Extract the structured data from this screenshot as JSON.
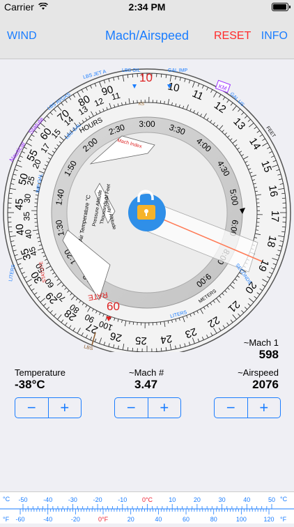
{
  "status": {
    "carrier": "Carrier",
    "time": "2:34 PM"
  },
  "nav": {
    "left": "WIND",
    "title": "Mach/Airspeed",
    "reset": "RESET",
    "info": "INFO"
  },
  "colors": {
    "accent": "#1a7dff",
    "reset": "#ff2a2a",
    "lock": "#2f8fe8"
  },
  "dial": {
    "outer_scale": [
      "10",
      "11",
      "12",
      "13",
      "14",
      "15",
      "16",
      "17",
      "18",
      "19",
      "20",
      "21",
      "22",
      "23",
      "24",
      "25",
      "26",
      "27",
      "28",
      "29",
      "30",
      "35",
      "40",
      "45",
      "50",
      "55",
      "60",
      "70",
      "80",
      "90"
    ],
    "inner_scale": [
      "100",
      "90",
      "80",
      "70",
      "60",
      "50",
      "45",
      "40",
      "35",
      "30",
      "25",
      "20",
      "17",
      "15",
      "14",
      "13",
      "12",
      "11"
    ],
    "time_scale": [
      "1:10",
      "1:20",
      "1:30",
      "1:40",
      "1:50",
      "2:00",
      "2:30",
      "3:00",
      "3:30",
      "4:00",
      "4:30",
      "5:00",
      "6:00",
      "8:00",
      "9:00"
    ],
    "labels": {
      "hours": "HOURS",
      "rate": "RATE",
      "seconds": "SECONDS",
      "liters": "LITERS",
      "lbs": "LBS",
      "lbs_oil": "LBS OIL",
      "gal_imp": "GAL IMP",
      "lbs_jet_a": "LBS JET A",
      "lbs_avgas": "LBS AVGAS",
      "gal_us": "GAL US",
      "lbs_gal": "LBS GAL",
      "km": "KM",
      "feet": "FEET",
      "meters": "METERS",
      "nautical": "Nautical",
      "statute": "Statute",
      "imp_gal": "IMP GAL",
      "statute2": "STATUTE",
      "air_temp": "Air Temperature °C",
      "pressure_alt": "Pressure Altitude",
      "thousands_ft": "Thousands of Feet",
      "density_alt": "Density Altitude",
      "mach_index": "Mach Index",
      "ks": "KS",
      "red_10": "10",
      "red_60": "60"
    }
  },
  "readouts": {
    "mach1_label": "~Mach 1",
    "mach1_value": "598",
    "temp_label": "Temperature",
    "temp_value": "-38°C",
    "mach_label": "~Mach #",
    "mach_value": "3.47",
    "airspeed_label": "~Airspeed",
    "airspeed_value": "2076"
  },
  "stepper": {
    "minus": "−",
    "plus": "+"
  },
  "temperature_bar": {
    "c_label": "°C",
    "f_label": "°F",
    "c_ticks": [
      "-50",
      "-40",
      "-30",
      "-20",
      "-10",
      "0°C",
      "10",
      "20",
      "30",
      "40",
      "50"
    ],
    "f_ticks": [
      "-60",
      "-40",
      "-20",
      "0°F",
      "20",
      "40",
      "60",
      "80",
      "100",
      "120"
    ]
  }
}
